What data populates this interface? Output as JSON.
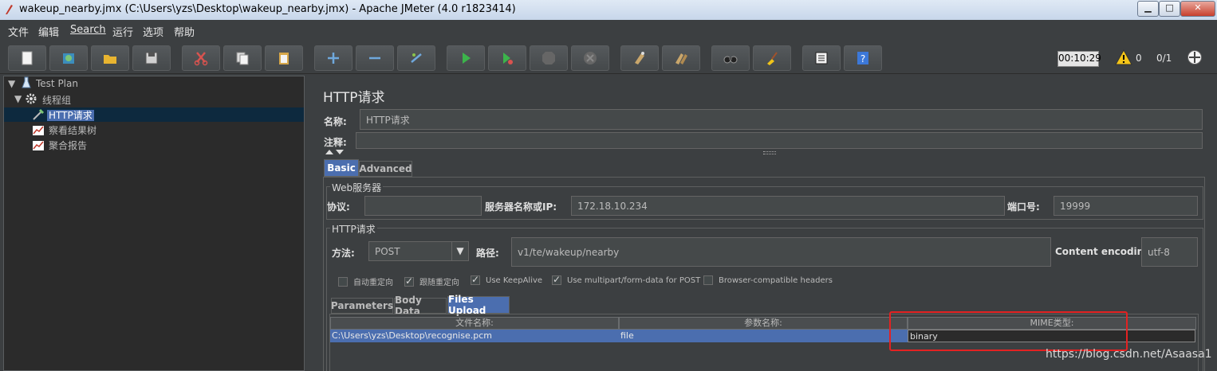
{
  "window": {
    "title": "wakeup_nearby.jmx (C:\\Users\\yzs\\Desktop\\wakeup_nearby.jmx) - Apache JMeter (4.0 r1823414)",
    "minimize_glyph": "▁",
    "maximize_glyph": "□",
    "close_glyph": "✕"
  },
  "menu": [
    "文件",
    "编辑",
    "Search",
    "运行",
    "选项",
    "帮助"
  ],
  "toolbar": {
    "buttons": [
      "new-icon",
      "templates-icon",
      "open-icon",
      "save-icon",
      "cut-icon",
      "copy-icon",
      "paste-icon",
      "expand-icon",
      "collapse-icon",
      "toggle-icon",
      "start-icon",
      "start-no-pause-icon",
      "stop-icon",
      "shutdown-icon",
      "clear-icon",
      "clear-all-icon",
      "search-icon",
      "reset-search-icon",
      "function-helper-icon",
      "help-icon"
    ],
    "timer": "00:10:29",
    "warnings": "0",
    "threads": "0/1"
  },
  "tree": {
    "root": "Test Plan",
    "thread_group": "线程组",
    "children": [
      "HTTP请求",
      "察看结果树",
      "聚合报告"
    ]
  },
  "panel": {
    "title": "HTTP请求",
    "name_label": "名称:",
    "name_value": "HTTP请求",
    "comment_label": "注释:",
    "tabs": [
      "Basic",
      "Advanced"
    ],
    "web_server": {
      "title": "Web服务器",
      "protocol_label": "协议:",
      "protocol_value": "",
      "server_label": "服务器名称或IP:",
      "server_value": "172.18.10.234",
      "port_label": "端口号:",
      "port_value": "19999"
    },
    "http_request": {
      "title": "HTTP请求",
      "method_label": "方法:",
      "method_value": "POST",
      "path_label": "路径:",
      "path_value": "v1/te/wakeup/nearby",
      "encoding_label": "Content encoding:",
      "encoding_value": "utf-8"
    },
    "checkboxes": [
      {
        "label": "自动重定向",
        "checked": false
      },
      {
        "label": "跟随重定向",
        "checked": true
      },
      {
        "label": "Use KeepAlive",
        "checked": true
      },
      {
        "label": "Use multipart/form-data for POST",
        "checked": true
      },
      {
        "label": "Browser-compatible headers",
        "checked": false
      }
    ],
    "subtabs": [
      "Parameters",
      "Body Data",
      "Files Upload"
    ],
    "files_table": {
      "headers": [
        "文件名称:",
        "参数名称:",
        "MIME类型:"
      ],
      "row": [
        "C:\\Users\\yzs\\Desktop\\recognise.pcm",
        "file",
        "binary"
      ]
    }
  },
  "watermark": "https://blog.csdn.net/Asaasa1",
  "colors": {
    "accent": "#4b6eaf",
    "highlight_box": "#e32222"
  }
}
